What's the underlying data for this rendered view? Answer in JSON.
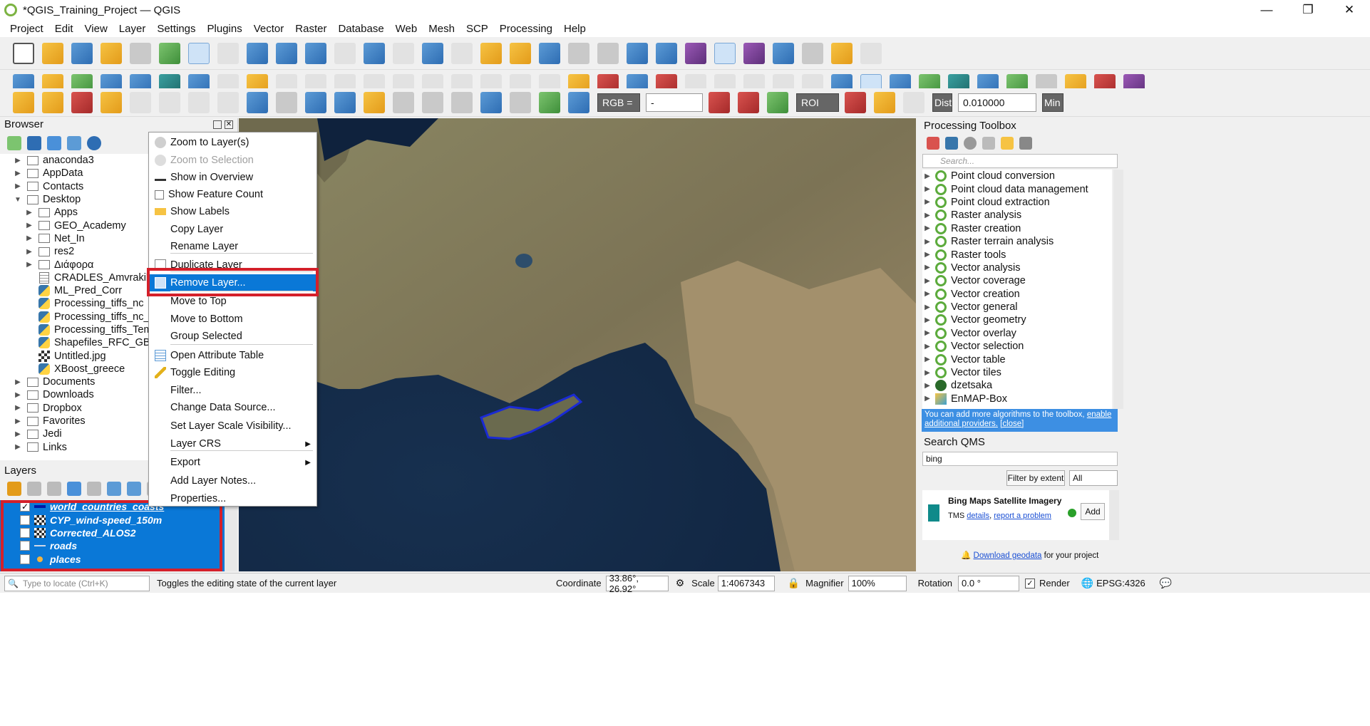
{
  "window": {
    "title": "*QGIS_Training_Project — QGIS",
    "controls": [
      "—",
      "❐",
      "✕"
    ]
  },
  "menubar": [
    "Project",
    "Edit",
    "View",
    "Layer",
    "Settings",
    "Plugins",
    "Vector",
    "Raster",
    "Database",
    "Web",
    "Mesh",
    "SCP",
    "Processing",
    "Help"
  ],
  "toolbar3": {
    "rgb_label": "RGB =",
    "rgb_value": "-",
    "roi_label": "ROI",
    "dist_label": "Dist",
    "dist_value": "0.010000",
    "min_label": "Min"
  },
  "browser": {
    "title": "Browser",
    "items": [
      {
        "label": "anaconda3",
        "icon": "folder",
        "level": 1,
        "arrow": "▶"
      },
      {
        "label": "AppData",
        "icon": "folder",
        "level": 1,
        "arrow": "▶"
      },
      {
        "label": "Contacts",
        "icon": "folder",
        "level": 1,
        "arrow": "▶"
      },
      {
        "label": "Desktop",
        "icon": "folder",
        "level": 1,
        "arrow": "▼"
      },
      {
        "label": "Apps",
        "icon": "folder",
        "level": 2,
        "arrow": "▶"
      },
      {
        "label": "GEO_Academy",
        "icon": "folder",
        "level": 2,
        "arrow": "▶"
      },
      {
        "label": "Net_In",
        "icon": "folder",
        "level": 2,
        "arrow": "▶"
      },
      {
        "label": "res2",
        "icon": "folder",
        "level": 2,
        "arrow": "▶"
      },
      {
        "label": "Διάφορα",
        "icon": "folder",
        "level": 2,
        "arrow": "▶"
      },
      {
        "label": "CRADLES_Amvrakikos.csv",
        "icon": "csv",
        "level": 2,
        "arrow": ""
      },
      {
        "label": "ML_Pred_Corr",
        "icon": "python",
        "level": 2,
        "arrow": ""
      },
      {
        "label": "Processing_tiffs_nc",
        "icon": "python",
        "level": 2,
        "arrow": ""
      },
      {
        "label": "Processing_tiffs_nc_Big",
        "icon": "python",
        "level": 2,
        "arrow": ""
      },
      {
        "label": "Processing_tiffs_Temp_nc",
        "icon": "python",
        "level": 2,
        "arrow": ""
      },
      {
        "label": "Shapefiles_RFC_GBC",
        "icon": "python",
        "level": 2,
        "arrow": ""
      },
      {
        "label": "Untitled.jpg",
        "icon": "image",
        "level": 2,
        "arrow": ""
      },
      {
        "label": "XBoost_greece",
        "icon": "python",
        "level": 2,
        "arrow": ""
      },
      {
        "label": "Documents",
        "icon": "folder",
        "level": 1,
        "arrow": "▶"
      },
      {
        "label": "Downloads",
        "icon": "folder",
        "level": 1,
        "arrow": "▶"
      },
      {
        "label": "Dropbox",
        "icon": "folder",
        "level": 1,
        "arrow": "▶"
      },
      {
        "label": "Favorites",
        "icon": "folder",
        "level": 1,
        "arrow": "▶"
      },
      {
        "label": "Jedi",
        "icon": "folder",
        "level": 1,
        "arrow": "▶"
      },
      {
        "label": "Links",
        "icon": "folder",
        "level": 1,
        "arrow": "▶"
      }
    ]
  },
  "layers": {
    "title": "Layers",
    "items": [
      {
        "label": "world_countries_coasts",
        "checked": true,
        "underline": true,
        "symbol": "line"
      },
      {
        "label": "CYP_wind-speed_150m",
        "checked": false,
        "underline": false,
        "symbol": "raster"
      },
      {
        "label": "Corrected_ALOS2",
        "checked": false,
        "underline": false,
        "symbol": "raster"
      },
      {
        "label": "roads",
        "checked": false,
        "underline": false,
        "symbol": "thinline"
      },
      {
        "label": "places",
        "checked": false,
        "underline": false,
        "symbol": "point"
      }
    ]
  },
  "context_menu": {
    "items": [
      {
        "label": "Zoom to Layer(s)",
        "disabled": false,
        "icon": "zoom-layer-icon"
      },
      {
        "label": "Zoom to Selection",
        "disabled": true,
        "icon": "zoom-selection-icon"
      },
      {
        "label": "Show in Overview",
        "disabled": false,
        "icon": "overview-icon"
      },
      {
        "label": "Show Feature Count",
        "disabled": false,
        "icon": "checkbox-icon"
      },
      {
        "label": "Show Labels",
        "disabled": false,
        "icon": "labels-icon"
      },
      {
        "label": "Copy Layer",
        "disabled": false,
        "icon": ""
      },
      {
        "label": "Rename Layer",
        "disabled": false,
        "icon": ""
      },
      {
        "label": "Duplicate Layer",
        "disabled": false,
        "icon": "duplicate-icon"
      },
      {
        "label": "Remove Layer...",
        "disabled": false,
        "icon": "remove-icon",
        "highlighted": true
      },
      {
        "label": "Move to Top",
        "disabled": false,
        "icon": ""
      },
      {
        "label": "Move to Bottom",
        "disabled": false,
        "icon": ""
      },
      {
        "label": "Group Selected",
        "disabled": false,
        "icon": ""
      },
      {
        "label": "Open Attribute Table",
        "disabled": false,
        "icon": "table-icon"
      },
      {
        "label": "Toggle Editing",
        "disabled": false,
        "icon": "pencil-icon"
      },
      {
        "label": "Filter...",
        "disabled": false,
        "icon": ""
      },
      {
        "label": "Change Data Source...",
        "disabled": false,
        "icon": ""
      },
      {
        "label": "Set Layer Scale Visibility...",
        "disabled": false,
        "icon": ""
      },
      {
        "label": "Layer CRS",
        "disabled": false,
        "icon": "",
        "submenu": true
      },
      {
        "label": "Export",
        "disabled": false,
        "icon": "",
        "submenu": true
      },
      {
        "label": "Add Layer Notes...",
        "disabled": false,
        "icon": ""
      },
      {
        "label": "Properties...",
        "disabled": false,
        "icon": ""
      }
    ]
  },
  "processing": {
    "title": "Processing Toolbox",
    "search_placeholder": "Search...",
    "algorithms": [
      "Point cloud conversion",
      "Point cloud data management",
      "Point cloud extraction",
      "Raster analysis",
      "Raster creation",
      "Raster terrain analysis",
      "Raster tools",
      "Vector analysis",
      "Vector coverage",
      "Vector creation",
      "Vector general",
      "Vector geometry",
      "Vector overlay",
      "Vector selection",
      "Vector table",
      "Vector tiles",
      "dzetsaka",
      "EnMAP-Box"
    ],
    "info_text": "You can add more algorithms to the toolbox,",
    "info_link1": "enable additional providers.",
    "info_link2": "[close]"
  },
  "qms": {
    "title": "Search QMS",
    "query": "bing",
    "filter_button": "Filter by extent",
    "filter_select": "All",
    "result_title": "Bing Maps Satellite Imagery",
    "result_type": "TMS",
    "details_link": "details",
    "report_link": "report a problem",
    "add_button": "Add",
    "download_link": "Download geodata",
    "download_suffix": "for your project"
  },
  "statusbar": {
    "locate_placeholder": "Type to locate (Ctrl+K)",
    "message": "Toggles the editing state of the current layer",
    "coordinate_label": "Coordinate",
    "coordinate_value": "33.86°, 26.92°",
    "scale_label": "Scale",
    "scale_value": "1:4067343",
    "magnifier_label": "Magnifier",
    "magnifier_value": "100%",
    "rotation_label": "Rotation",
    "rotation_value": "0.0 °",
    "render_label": "Render",
    "crs": "EPSG:4326"
  }
}
